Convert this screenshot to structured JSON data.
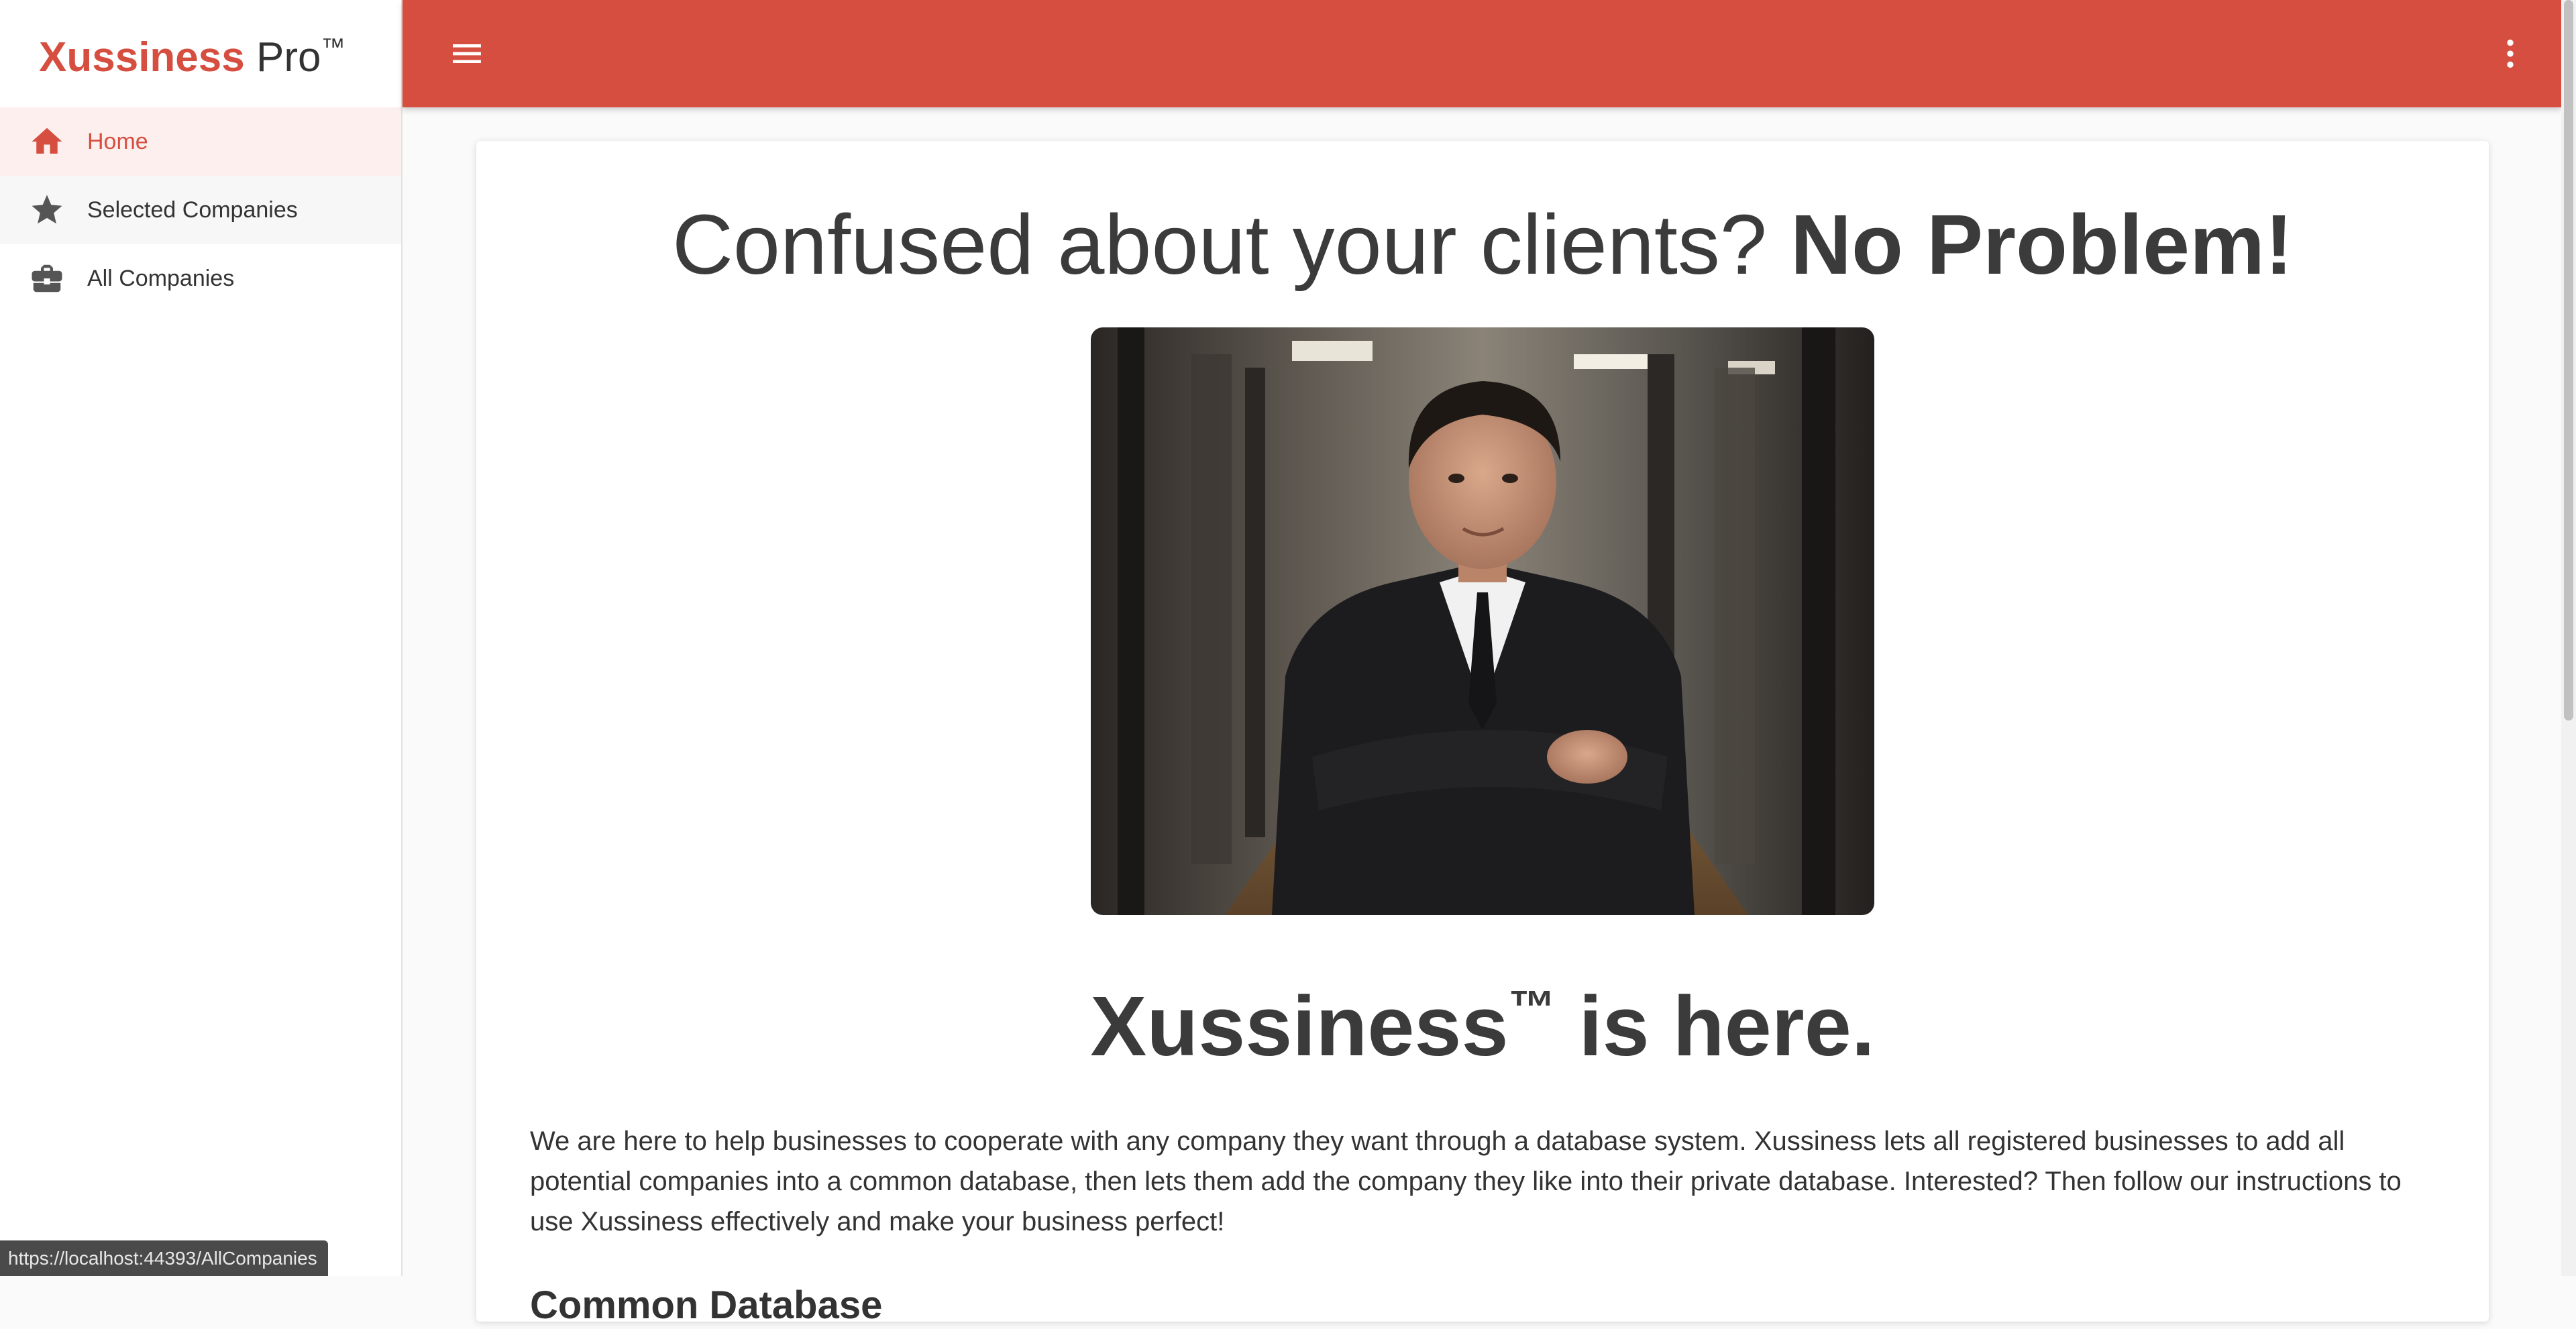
{
  "brand": {
    "name": "Xussiness",
    "suffix": " Pro",
    "trademark": "™"
  },
  "sidebar": {
    "items": [
      {
        "label": "Home",
        "icon": "home-icon",
        "active": true
      },
      {
        "label": "Selected Companies",
        "icon": "star-icon",
        "active": false
      },
      {
        "label": "All Companies",
        "icon": "briefcase-icon",
        "active": false
      }
    ]
  },
  "appbar": {
    "menu_icon": "menu-icon",
    "more_icon": "more-vert-icon"
  },
  "main": {
    "headline_regular": "Confused about your clients? ",
    "headline_bold": "No Problem!",
    "tagline_bold": "Xussiness",
    "tagline_tm": "™",
    "tagline_rest": " is here.",
    "body": "We are here to help businesses to cooperate with any company they want through a database system. Xussiness lets all registered businesses to add all potential companies into a common database, then lets them add the company they like into their private database. Interested? Then follow our instructions to use Xussiness effectively and make your business perfect!",
    "section_title": "Common Database"
  },
  "status_bar": {
    "url": "https://localhost:44393/AllCompanies"
  },
  "colors": {
    "accent": "#d64e3f",
    "active_bg": "#fcefed",
    "sidebar_bg": "#ffffff",
    "page_bg": "#fafafa"
  }
}
